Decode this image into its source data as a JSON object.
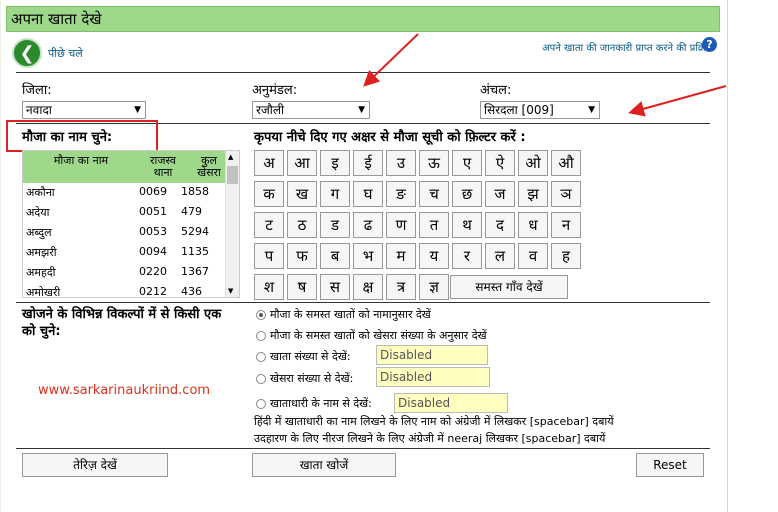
{
  "header": {
    "title": "अपना खाता देखे"
  },
  "nav": {
    "back_label": "पीछे चले",
    "help_text": "अपने खाता की जानकारी प्राप्त करने की प्रक्रिया",
    "help_icon": "?"
  },
  "filters": {
    "district": {
      "label": "जिला:",
      "value": "नवादा"
    },
    "subdivision": {
      "label": "अनुमंडल:",
      "value": "रजौली"
    },
    "circle": {
      "label": "अंचल:",
      "value": "सिरदला [009]"
    }
  },
  "mouza": {
    "label": "मौजा का नाम चुने:",
    "columns": [
      "मौजा का नाम",
      "राजस्व थाना",
      "कुल खेसरा"
    ],
    "rows": [
      [
        "अकौना",
        "0069",
        "1858"
      ],
      [
        "अदेया",
        "0051",
        "479"
      ],
      [
        "अब्दुल",
        "0053",
        "5294"
      ],
      [
        "अमझरी",
        "0094",
        "1135"
      ],
      [
        "अमहदी",
        "0220",
        "1367"
      ],
      [
        "अमोखरी",
        "0212",
        "436"
      ]
    ]
  },
  "alphabet": {
    "label": "कृपया नीचे दिए गए अक्षर से मौजा सूची को फ़िल्टर करें :",
    "letters": [
      "अ",
      "आ",
      "इ",
      "ई",
      "उ",
      "ऊ",
      "ए",
      "ऐ",
      "ओ",
      "औ",
      "क",
      "ख",
      "ग",
      "घ",
      "ङ",
      "च",
      "छ",
      "ज",
      "झ",
      "ञ",
      "ट",
      "ठ",
      "ड",
      "ढ",
      "ण",
      "त",
      "थ",
      "द",
      "ध",
      "न",
      "प",
      "फ",
      "ब",
      "भ",
      "म",
      "य",
      "र",
      "ल",
      "व",
      "ह",
      "श",
      "ष",
      "स",
      "क्ष",
      "त्र",
      "ज्ञ"
    ],
    "all_button": "समस्त गाँव देखें"
  },
  "search": {
    "label": "खोजने के विभिन्न विकल्पों में से किसी एक को चुने:",
    "options": [
      {
        "label": "मौजा के समस्त खातों को नामानुसार देखें",
        "checked": true
      },
      {
        "label": "मौजा के समस्त खातों को खेसरा संख्या के अनुसार देखें",
        "checked": false
      },
      {
        "label": "खाता संख्या से देखें:",
        "checked": false,
        "field": "Disabled"
      },
      {
        "label": "खेसरा संख्या से देखें:",
        "checked": false,
        "field": "Disabled"
      },
      {
        "label": "खाताधारी के नाम से देखें:",
        "checked": false,
        "field": "Disabled"
      }
    ],
    "note1": "हिंदी में खाताधारी का नाम लिखने के लिए नाम को अंग्रेजी में लिखकर [spacebar] दबायें",
    "note2": "उदहारण के लिए नीरज लिखने के लिए अंग्रेजी में neeraj लिखकर [spacebar] दबायें"
  },
  "watermark": "www.sarkarinaukriind.com",
  "buttons": {
    "ledger": "तेरिज़ देखें",
    "search": "खाता खोजें",
    "reset": "Reset"
  },
  "colors": {
    "header_bg": "#9ed88a",
    "highlight_red": "#e02020",
    "disabled_bg": "#ffffc0"
  }
}
